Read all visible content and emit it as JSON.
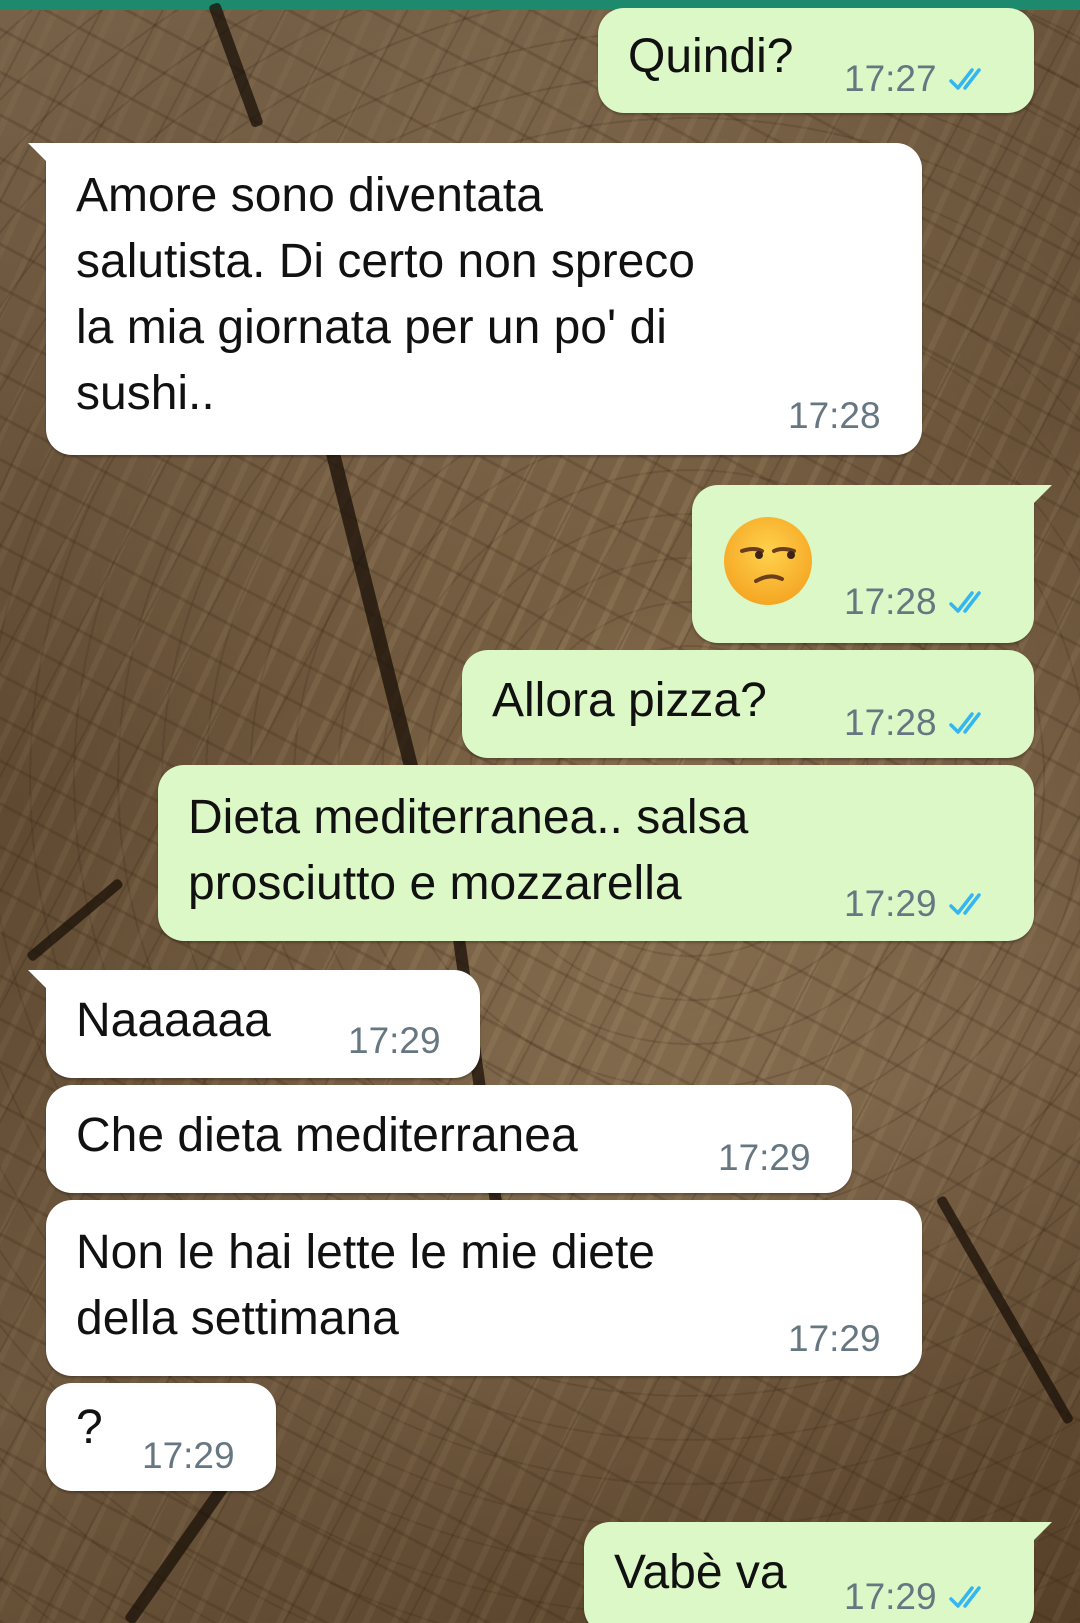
{
  "theme": {
    "header_color": "#1e8a6d",
    "outgoing_bubble": "#dcf8c6",
    "incoming_bubble": "#ffffff",
    "tick_color": "#34b7f1"
  },
  "messages": [
    {
      "direction": "out",
      "text": "Quindi?",
      "time": "17:27",
      "status": "read"
    },
    {
      "direction": "in",
      "text": "Amore sono diventata\nsalutista. Di certo non spreco\nla mia giornata per un po' di\nsushi..",
      "time": "17:28"
    },
    {
      "direction": "out",
      "emoji": "unamused-face-emoji",
      "time": "17:28",
      "status": "read"
    },
    {
      "direction": "out",
      "text": "Allora pizza?",
      "time": "17:28",
      "status": "read"
    },
    {
      "direction": "out",
      "text": "Dieta mediterranea.. salsa\nprosciutto e mozzarella",
      "time": "17:29",
      "status": "read"
    },
    {
      "direction": "in",
      "text": "Naaaaaa",
      "time": "17:29"
    },
    {
      "direction": "in",
      "text": "Che dieta mediterranea",
      "time": "17:29"
    },
    {
      "direction": "in",
      "text": "Non le hai lette le mie diete\ndella settimana",
      "time": "17:29"
    },
    {
      "direction": "in",
      "text": "?",
      "time": "17:29"
    },
    {
      "direction": "out",
      "text": "Vabè va",
      "time": "17:29",
      "status": "read"
    }
  ]
}
